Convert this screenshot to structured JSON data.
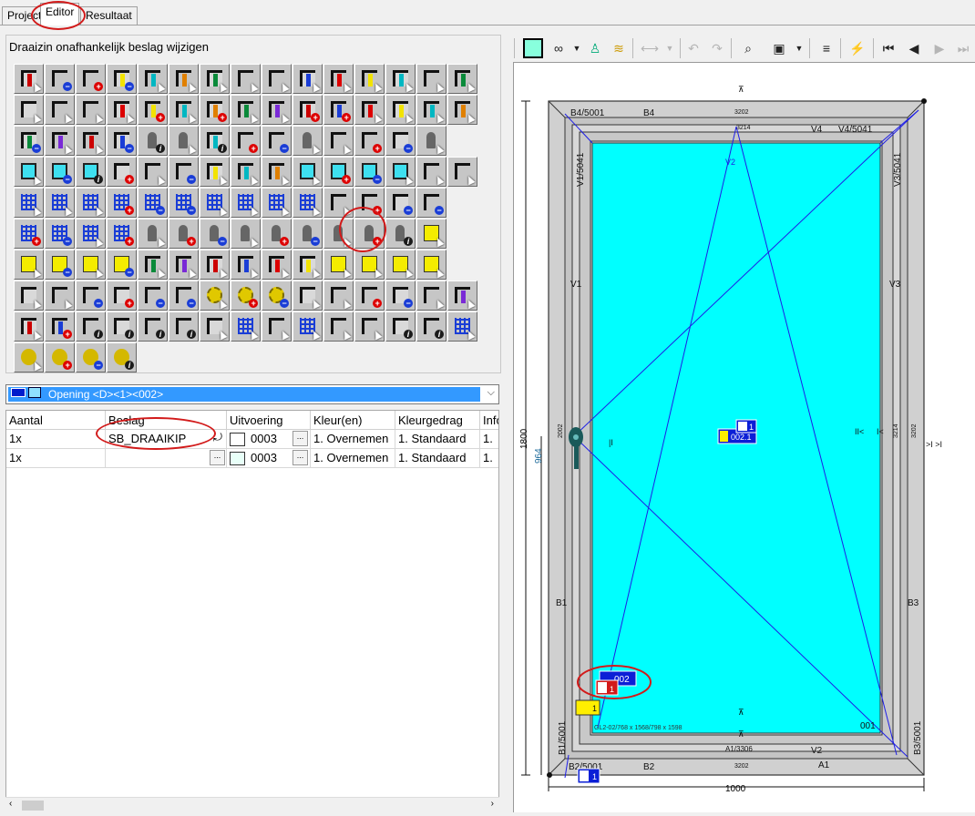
{
  "tabs": [
    {
      "label": "Project"
    },
    {
      "label": "Editor"
    },
    {
      "label": "Resultaat"
    }
  ],
  "palette": {
    "title": "Draaizin onafhankelijk beslag wijzigen"
  },
  "opening": {
    "label": "Opening <D><1><002>"
  },
  "table": {
    "columns": [
      "Aantal",
      "Beslag",
      "Uitvoering",
      "Kleur(en)",
      "Kleurgedrag",
      "Info"
    ],
    "rows": [
      {
        "aantal": "1x",
        "beslag": "SB_DRAAIKIP",
        "uitvoering": "0003",
        "kleur": "1. Overnemen",
        "kleurgedrag": "1. Standaard",
        "info": "1."
      },
      {
        "aantal": "1x",
        "beslag": "",
        "uitvoering": "0003",
        "kleur": "1. Overnemen",
        "kleurgedrag": "1. Standaard",
        "info": "1."
      }
    ]
  },
  "drawing": {
    "labels": {
      "b4_5001": "B4/5001",
      "b4": "B4",
      "v4": "V4",
      "v4_5041": "V4/5041",
      "v1_5041": "V1/5041",
      "v3_5041": "V3/5041",
      "v1": "V1",
      "v3": "V3",
      "b1": "B1",
      "b3": "B3",
      "a1_3306": "A1/3306",
      "v2": "V2",
      "b2_5001": "B2/5001",
      "b2": "B2",
      "a1": "A1",
      "b1_5001": "B1/5001",
      "b3_5001": "B3/5001",
      "n3202_top": "3202",
      "n3214_top": "3214",
      "n3202_bottom": "3202",
      "n3214_right": "3214",
      "n3202_right": "3202",
      "n2002": "2002",
      "v2_small": "V2",
      "glass": "GL2-02/768 x 1568/798 x 1598",
      "sash_code": "001",
      "node_002": "002",
      "node_002_1": "002.1",
      "node_1a": "1",
      "node_1b": "1",
      "node_1c": "1",
      "node_1d": "1",
      "dim_width": "1000",
      "dim_height": "1800",
      "dim_964": "964",
      "arrow_r1": "II<",
      "arrow_r2": "I<",
      "arrow_r3": ">I >I",
      "mid_marker": "|I"
    },
    "colors": {
      "glass": "#00ffff",
      "frame": "#d0d0d0",
      "line": "#1e1ee6",
      "highlight": "#d21a1a",
      "badge_blue": "#0b1fd6",
      "badge_yellow": "#ffee00"
    }
  },
  "icons": [
    "corner-profile",
    "frame-minus",
    "frame-plus",
    "bar-minus",
    "bar-arrows",
    "bar-select",
    "bar-select-2",
    "p-icon-1",
    "p-icon-2",
    "sash-pencil",
    "sash-pencil-2",
    "sash-pencil-3",
    "sash-pencil-4",
    "book-icon",
    "bar-move",
    "double-arrow",
    "hand-arrows",
    "diag-arrow",
    "diag-red",
    "sash-plus",
    "sash-select",
    "sash-plus-2",
    "bar-hand",
    "bar-hand-2",
    "bar-plus",
    "bar-plus-2",
    "bar-hand-3",
    "bar-hand-4",
    "bar-hand-5",
    "bar-hand-6",
    "mullion-minus",
    "mullion-select",
    "mullion-red",
    "mullion-minus-2",
    "handle-info",
    "handle-hand",
    "corner-info",
    "x-plus",
    "x-minus",
    "x-lock",
    "y-hand",
    "y-plus",
    "y-minus",
    "y-lock",
    "",
    "glass-frame",
    "glass-minus",
    "glass-info",
    "fitting-plus",
    "fitting-select",
    "fitting-minus",
    "bar-red",
    "bar-red-2",
    "bar-red-3",
    "glass-select",
    "glass-plus",
    "glass-minus-2",
    "glass-hand",
    "split-h",
    "split-v",
    "grid-diag",
    "grid-select",
    "grid-hand",
    "grid-plus",
    "grid-minus",
    "grid-minus-2",
    "grid-hash",
    "grid-hash-2",
    "grid-panel",
    "grid-panel-2",
    "stack-select",
    "stack-plus",
    "stack-minus",
    "stack-minus-2",
    "",
    "dots-plus",
    "dots-minus",
    "dots-select",
    "dots-plus-2",
    "hinge-select",
    "hinge-plus",
    "hinge-minus",
    "handle-select",
    "handle-plus",
    "handle-minus",
    "lock-select",
    "lock-plus",
    "lock-info",
    "yellow-select",
    "",
    "yellow-arrow",
    "yellow-minus",
    "yellow-copy",
    "yellow-minus-2",
    "sash-open",
    "sash-open-2",
    "sash-open-3",
    "sash-open-4",
    "sash-open-5",
    "sash-open-6",
    "yellow-tag",
    "yellow-tag-2",
    "yellow-tag-3",
    "yellow-hand",
    "",
    "tool-select",
    "tool-hand",
    "tool-minus",
    "rect-plus",
    "rect-minus",
    "rect-minus-2",
    "gear-select",
    "gear-plus",
    "gear-minus",
    "screw-select",
    "screw-hand",
    "screw-plus",
    "screw-minus",
    "screw-vk",
    "corner-frame",
    "corner-red",
    "corner-plus",
    "profile-info",
    "layout-info",
    "dim-info",
    "trim-info",
    "i-profile",
    "window-grid",
    "move-green",
    "hand-grid",
    "panel-hand",
    "half-fraction",
    "window-info",
    "cube-info",
    "dots-house",
    "coins-select",
    "coins-plus",
    "coins-minus",
    "coins-info"
  ]
}
